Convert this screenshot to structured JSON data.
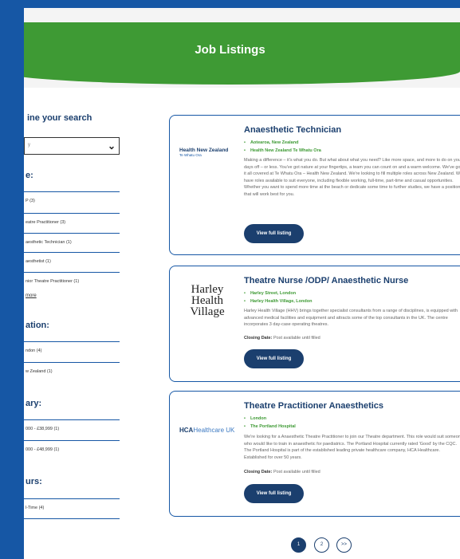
{
  "header": {
    "title": "Job Listings"
  },
  "sidebar": {
    "title": "ine your search",
    "sort_value": "y",
    "groups": [
      {
        "title": "e:",
        "options": [
          "P (3)",
          "eatre Practitioner (3)",
          "aesthetic Technician (1)",
          "aesthetist (1)",
          "nior Theatre Practitioner (1)"
        ],
        "more": "more"
      },
      {
        "title": "ation:",
        "options": [
          "ndon (4)",
          "w Zealand (1)"
        ]
      },
      {
        "title": "ary:",
        "options": [
          "000 - £38,999 (1)",
          "000 - £48,999 (1)"
        ]
      },
      {
        "title": "urs:",
        "options": [
          "l-Time (4)"
        ]
      }
    ]
  },
  "listings": [
    {
      "title": "Anaesthetic Technician",
      "logo": {
        "line1": "Health New Zealand",
        "line2": "Te Whatu Ora"
      },
      "meta": [
        "Aotearoa, New Zealand",
        "Health New Zealand Te Whatu Ora"
      ],
      "description": "Making a difference – it's what you do. But what about what you need? Like more space, and more to do on your days off – or less. You've got nature at your fingertips, a team you can count on and a warm welcome. We've got it all covered at Te Whatu Ora – Health New Zealand. We're looking to fill multiple roles across New Zealand. We have roles available to suit everyone, including flexible working, full-time, part-time and casual opportunities. Whether you want to spend more time at the beach or dedicate some time to further studies, we have a position that will work best for you.",
      "button": "View full listing"
    },
    {
      "title": "Theatre Nurse /ODP/ Anaesthetic Nurse",
      "logo": {
        "line1": "Harley",
        "line2": "Health",
        "line3": "Village"
      },
      "meta": [
        "Harley Street, London",
        "Harley Health Village, London"
      ],
      "description": "Harley Health Village (HHV) brings together specialist consultants from a range of disciplines, is equipped with advanced medical facilities and equipment and attracts some of the top consultants in the UK. The centre incorporates 3 day-case operating theatres.",
      "closing_label": "Closing Date:",
      "closing_value": "Post available until filled",
      "button": "View full listing"
    },
    {
      "title": "Theatre Practitioner Anaesthetics",
      "logo": {
        "part1": "HCA",
        "part2": "Healthcare UK"
      },
      "meta": [
        "London",
        "The Portland Hospital"
      ],
      "description": "We're looking for a Anaesthetic Theatre Practitioner to join our Theatre department. This role would suit someone who would like to train in anaesthetic for paediatrics. The Portland Hospital currently rated 'Good' by the CQC. The Portland Hospital is part of the established leading private healthcare company, HCA Healthcare. Established for over 50 years.",
      "closing_label": "Closing Date:",
      "closing_value": "Post available until filled",
      "button": "View full listing"
    }
  ],
  "pagination": {
    "pages": [
      "1",
      "2"
    ],
    "next": ">>",
    "current": "1"
  },
  "colors": {
    "brand_blue": "#1657a5",
    "navy": "#1b3f6e",
    "green": "#3e9a34"
  }
}
